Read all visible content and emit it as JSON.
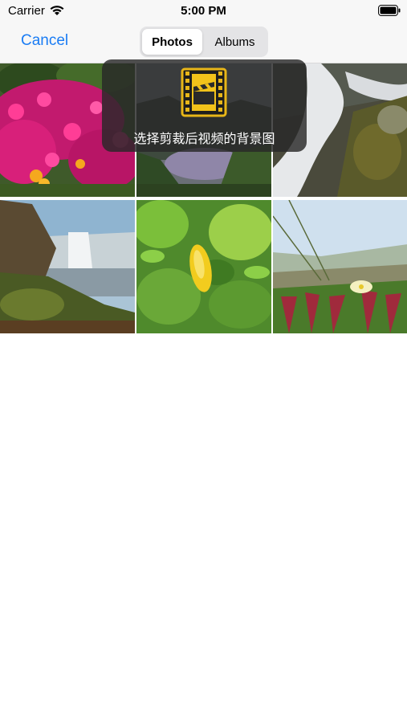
{
  "status_bar": {
    "carrier": "Carrier",
    "time": "5:00 PM"
  },
  "nav": {
    "cancel_label": "Cancel",
    "tabs": [
      {
        "label": "Photos",
        "selected": true
      },
      {
        "label": "Albums",
        "selected": false
      }
    ]
  },
  "toast": {
    "message": "选择剪裁后视频的背景图",
    "icon": "film-clapper-icon"
  },
  "photos": [
    {
      "name": "pink-flowers"
    },
    {
      "name": "lake-cliffs"
    },
    {
      "name": "rocky-waterfall"
    },
    {
      "name": "waterfall-cliff"
    },
    {
      "name": "lemon-tree"
    },
    {
      "name": "coastal-flowers"
    }
  ],
  "colors": {
    "accent": "#1a7cf4",
    "toast_bg": "#282828"
  }
}
